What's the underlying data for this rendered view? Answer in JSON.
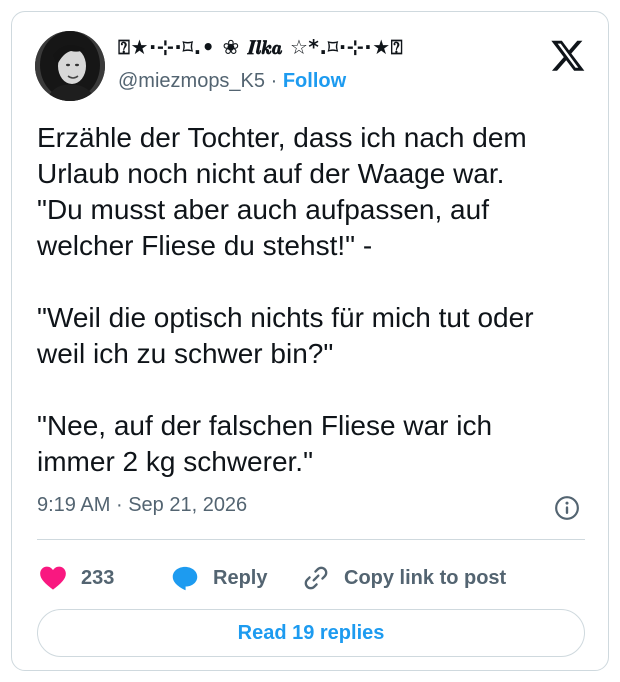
{
  "author": {
    "display_name": "⍰★·⊹·⌑.• ❀ 𝑰𝒍𝒌𝒂 ☆*.⌑·⊹·★⍰",
    "handle": "@miezmops_K5",
    "separator": "·",
    "follow_label": "Follow",
    "avatar_icon": "user-avatar"
  },
  "brand": {
    "logo_icon": "x-logo-icon"
  },
  "tweet": {
    "text": "Erzähle der Tochter, dass ich nach dem\nUrlaub noch nicht auf der Waage war.\n\"Du musst aber auch aufpassen, auf\nwelcher Fliese du stehst!\" -\n\n\"Weil die optisch nichts für mich tut oder\nweil ich zu schwer bin?\"\n\n\"Nee, auf der falschen Fliese war ich\nimmer 2 kg schwerer.\"",
    "time": "9:19 AM",
    "date_separator": "·",
    "date": "Sep 21, 2026"
  },
  "actions": {
    "likes_count": "233",
    "reply_label": "Reply",
    "copy_label": "Copy link to post",
    "read_replies_label": "Read 19 replies"
  },
  "colors": {
    "like_heart": "#f91880",
    "reply_bubble": "#1d9bf0",
    "link_blue": "#1d9bf0",
    "muted_text": "#536471",
    "border": "#cfd9de"
  }
}
